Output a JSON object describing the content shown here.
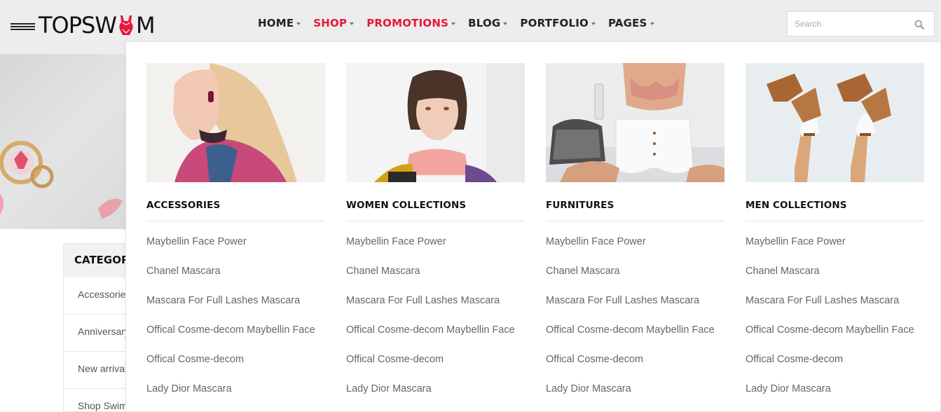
{
  "brand": {
    "logo_text_left": "TOPSW",
    "logo_text_right": "M"
  },
  "nav": {
    "items": [
      {
        "label": "HOME",
        "active": false
      },
      {
        "label": "SHOP",
        "active": true
      },
      {
        "label": "PROMOTIONS",
        "active": true
      },
      {
        "label": "BLOG",
        "active": false
      },
      {
        "label": "PORTFOLIO",
        "active": false
      },
      {
        "label": "PAGES",
        "active": false
      }
    ]
  },
  "search": {
    "placeholder": "Search",
    "value": ""
  },
  "sidebar": {
    "title": "CATEGORIES",
    "items": [
      {
        "label": "Accessories"
      },
      {
        "label": "Anniversary"
      },
      {
        "label": "New arrivals"
      },
      {
        "label": "Shop Swimwear"
      }
    ]
  },
  "mega_menu": {
    "columns": [
      {
        "heading": "ACCESSORIES",
        "links": [
          "Maybellin Face Power",
          "Chanel Mascara",
          "Mascara For Full Lashes Mascara",
          "Offical Cosme-decom Maybellin Face",
          "Offical Cosme-decom",
          "Lady Dior Mascara"
        ]
      },
      {
        "heading": "WOMEN COLLECTIONS",
        "links": [
          "Maybellin Face Power",
          "Chanel Mascara",
          "Mascara For Full Lashes Mascara",
          "Offical Cosme-decom Maybellin Face",
          "Offical Cosme-decom",
          "Lady Dior Mascara"
        ]
      },
      {
        "heading": "FURNITURES",
        "links": [
          "Maybellin Face Power",
          "Chanel Mascara",
          "Mascara For Full Lashes Mascara",
          "Offical Cosme-decom Maybellin Face",
          "Offical Cosme-decom",
          "Lady Dior Mascara"
        ]
      },
      {
        "heading": "MEN COLLECTIONS",
        "links": [
          "Maybellin Face Power",
          "Chanel Mascara",
          "Mascara For Full Lashes Mascara",
          "Offical Cosme-decom Maybellin Face",
          "Offical Cosme-decom",
          "Lady Dior Mascara"
        ]
      }
    ]
  },
  "colors": {
    "accent": "#e8163b",
    "header_bg": "#ededed",
    "text_dark": "#222222",
    "link_gray": "#666666"
  },
  "icons": {
    "menu": "hamburger-icon",
    "search": "search-icon",
    "caret": "chevron-down-icon",
    "logo": "swimsuit-icon"
  }
}
